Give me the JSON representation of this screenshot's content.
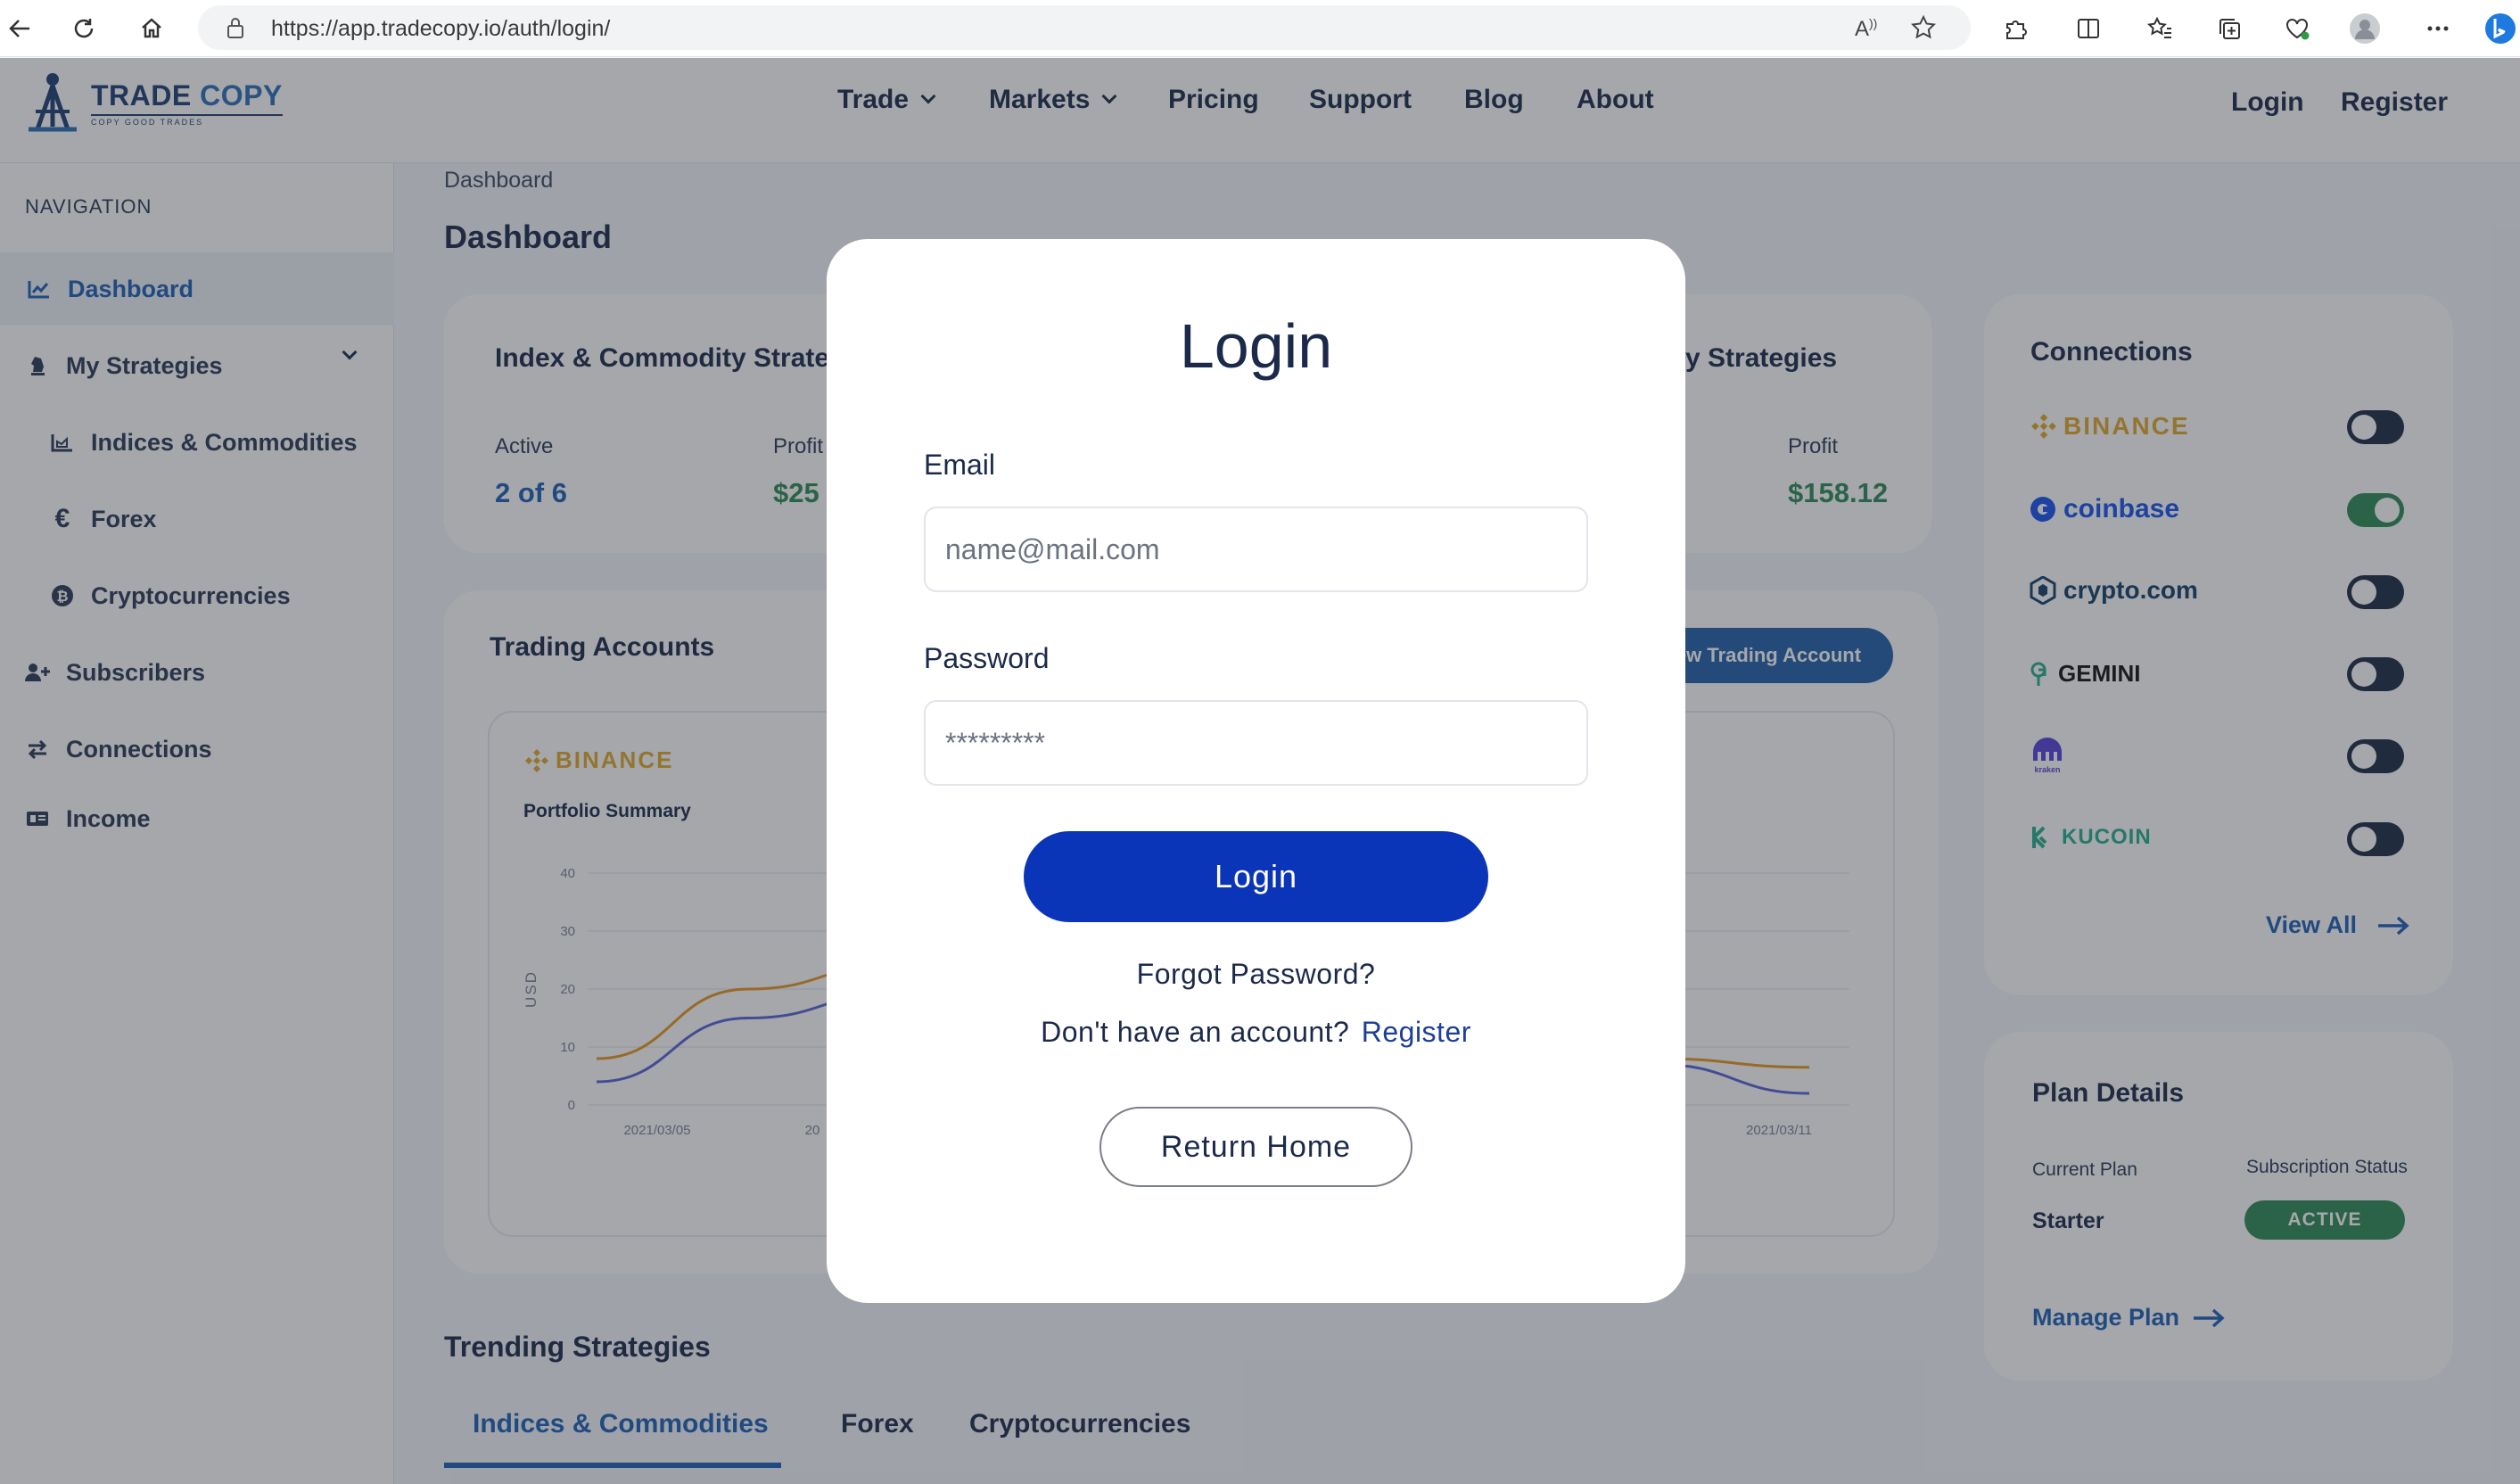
{
  "browser": {
    "url": "https://app.tradecopy.io/auth/login/"
  },
  "header": {
    "brand_name_a": "TRADE",
    "brand_name_b": "COPY",
    "brand_tagline": "COPY GOOD TRADES",
    "nav": {
      "trade": "Trade",
      "markets": "Markets",
      "pricing": "Pricing",
      "support": "Support",
      "blog": "Blog",
      "about": "About"
    },
    "login": "Login",
    "register": "Register"
  },
  "sidebar": {
    "label": "NAVIGATION",
    "dashboard": "Dashboard",
    "my_strategies": "My Strategies",
    "indices": "Indices & Commodities",
    "forex": "Forex",
    "crypto": "Cryptocurrencies",
    "subscribers": "Subscribers",
    "connections": "Connections",
    "income": "Income"
  },
  "main": {
    "breadcrumb": "Dashboard",
    "title": "Dashboard",
    "index_card": {
      "title": "Index & Commodity Strateg",
      "active_label": "Active",
      "active_value": "2 of 6",
      "profit_label": "Profit",
      "profit_value": "$25"
    },
    "crypto_card": {
      "title": "y Strategies",
      "profit_label": "Profit",
      "profit_value": "$158.12"
    },
    "trading_accounts": {
      "title": "Trading Accounts",
      "new_button": "New Trading Account",
      "exchange": "BINANCE",
      "portfolio": "Portfolio Summary",
      "y_axis": "USD",
      "y_ticks": [
        "40",
        "30",
        "20",
        "10",
        "0"
      ],
      "x_tick_first": "2021/03/05",
      "x_tick_cut": "20",
      "x_tick_last": "2021/03/11"
    },
    "trending": {
      "title": "Trending Strategies",
      "tabs": [
        "Indices & Commodities",
        "Forex",
        "Cryptocurrencies"
      ]
    }
  },
  "connections": {
    "title": "Connections",
    "items": [
      {
        "name": "BINANCE",
        "on": false,
        "color": "#e2a92b"
      },
      {
        "name": "coinbase",
        "on": true,
        "color": "#1652f0"
      },
      {
        "name": "crypto.com",
        "on": false,
        "color": "#103f68"
      },
      {
        "name": "GEMINI",
        "on": false,
        "color": "#111111"
      },
      {
        "name": "kraken",
        "on": false,
        "color": "#5741d9"
      },
      {
        "name": "KUCOIN",
        "on": false,
        "color": "#24ae8f"
      }
    ],
    "view_all": "View All"
  },
  "plan": {
    "title": "Plan Details",
    "current_label": "Current Plan",
    "status_label": "Subscription Status",
    "current_value": "Starter",
    "status_value": "ACTIVE",
    "manage": "Manage Plan"
  },
  "modal": {
    "title": "Login",
    "email_label": "Email",
    "email_placeholder": "name@mail.com",
    "password_label": "Password",
    "password_placeholder": "*********",
    "login_button": "Login",
    "forgot": "Forgot Password?",
    "no_account": "Don't have an account?",
    "register": "Register",
    "return_home": "Return Home"
  },
  "colors": {
    "primary": "#0a35b8",
    "brand": "#1c3f74",
    "profit_green": "#2e8b57",
    "binance": "#e2a92b",
    "overlay": "rgba(40,45,55,0.42)"
  },
  "chart_data": {
    "type": "line",
    "title": "Portfolio Summary",
    "ylabel": "USD",
    "ylim": [
      0,
      40
    ],
    "x_ticks_visible": [
      "2021/03/05",
      "2021/03/11"
    ],
    "series": [
      {
        "values": [
          8,
          20,
          24.5,
          24,
          20,
          14,
          10,
          8,
          6.5
        ]
      },
      {
        "values": [
          4,
          15,
          19.5,
          19,
          17,
          11,
          8,
          7,
          2
        ]
      }
    ]
  }
}
